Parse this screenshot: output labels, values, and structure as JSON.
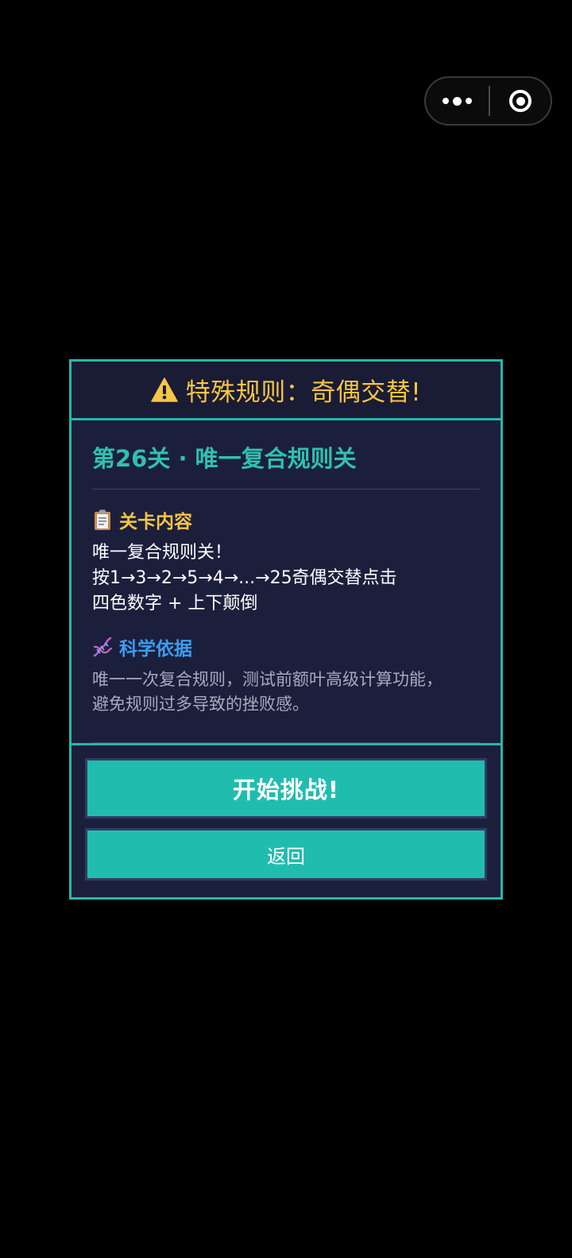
{
  "capsule": {
    "more_icon": "more-dots-icon",
    "close_icon": "target-circle-icon"
  },
  "modal": {
    "header_title": "特殊规则：奇偶交替!",
    "header_icon": "warning-triangle-icon",
    "level_title": "第26关 · 唯一复合规则关",
    "content_section": {
      "icon": "clipboard-icon",
      "title": "关卡内容",
      "lines": [
        "唯一复合规则关！",
        "按1→3→2→5→4→...→25奇偶交替点击",
        "四色数字 + 上下颠倒"
      ]
    },
    "science_section": {
      "icon": "dna-icon",
      "title": "科学依据",
      "lines": [
        "唯一一次复合规则，测试前额叶高级计算功能，",
        "避免规则过多导致的挫败感。"
      ]
    },
    "start_button": "开始挑战!",
    "back_button": "返回"
  },
  "colors": {
    "accent_teal": "#26b8a8",
    "button_fill": "#20bdaf",
    "title_yellow": "#f6c543",
    "science_blue": "#3d9cf0",
    "panel_bg": "#1c1f3c"
  }
}
